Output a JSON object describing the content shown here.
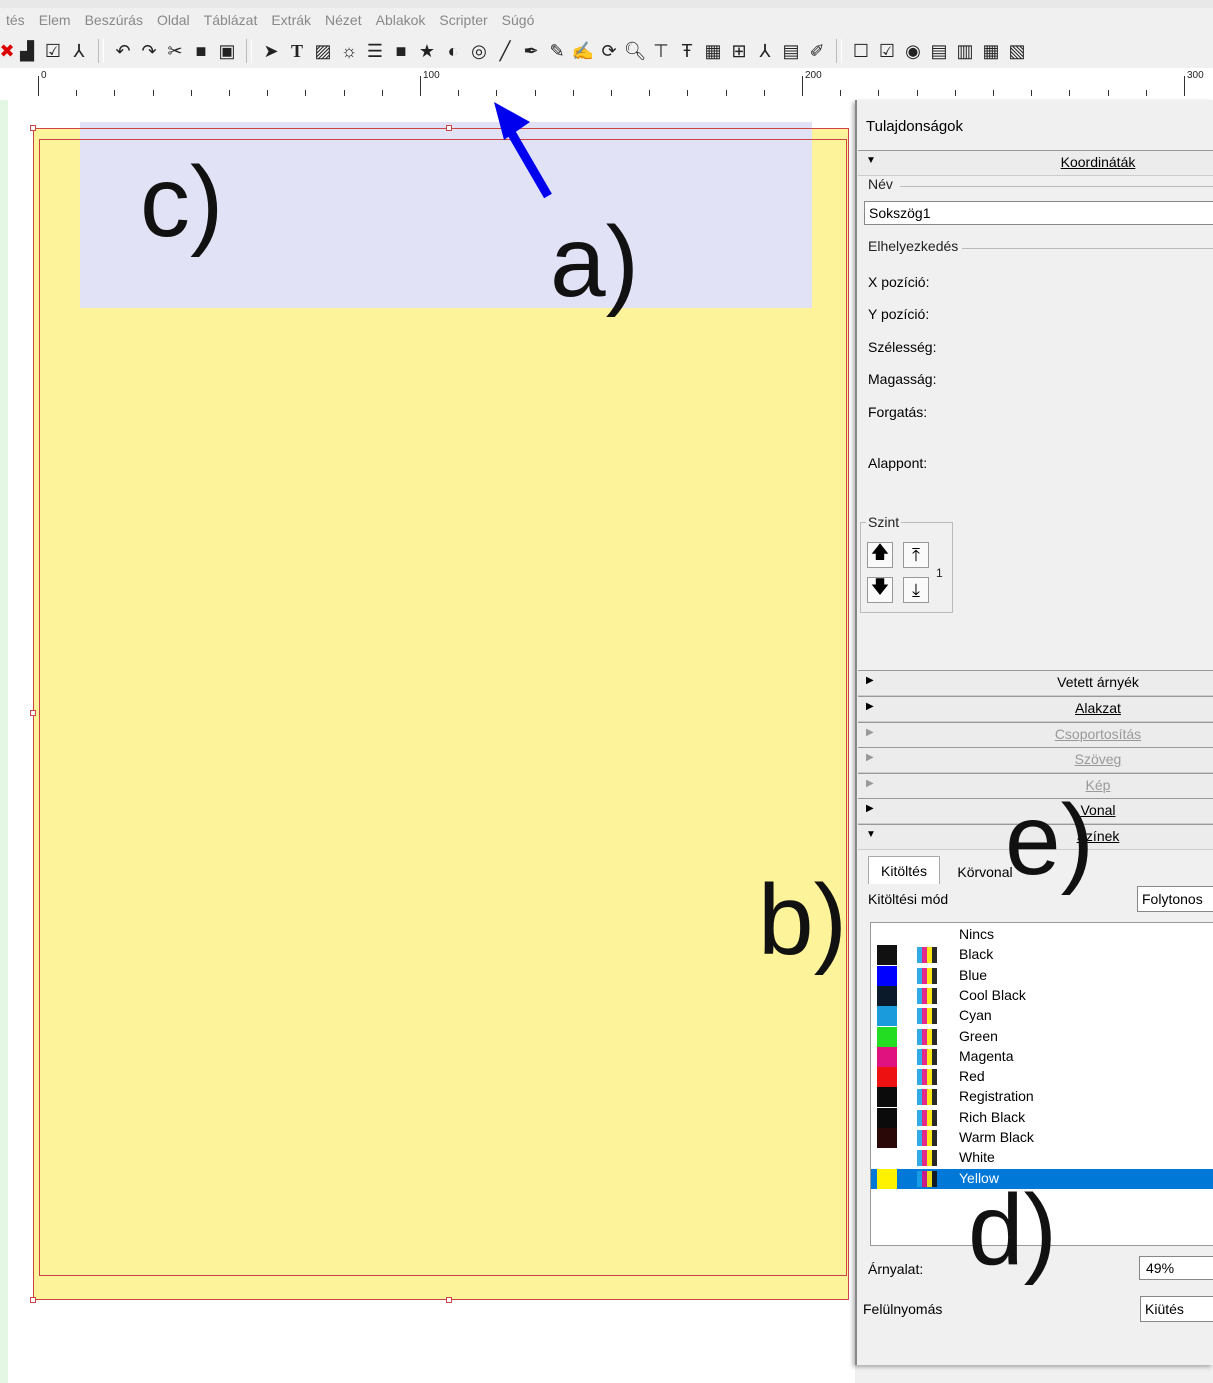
{
  "menubar": [
    "tés",
    "Elem",
    "Beszúrás",
    "Oldal",
    "Táblázat",
    "Extrák",
    "Nézet",
    "Ablakok",
    "Scripter",
    "Súgó"
  ],
  "ruler": {
    "labels": [
      "0",
      "100",
      "200",
      "300"
    ]
  },
  "annotations": {
    "a": "a)",
    "b": "b)",
    "c": "c)",
    "d": "d)",
    "e": "e)"
  },
  "panel": {
    "title": "Tulajdonságok",
    "sections": {
      "coordinates": "Koordináták",
      "shadow": "Vetett árnyék",
      "shape": "Alakzat",
      "grouping": "Csoportosítás",
      "text": "Szöveg",
      "image": "Kép",
      "line": "Vonal",
      "colors": "Színek"
    },
    "name_group": "Név",
    "name_value": "Sokszög1",
    "placement_group": "Elhelyezkedés",
    "fields": {
      "x": "X pozíció:",
      "y": "Y pozíció:",
      "width": "Szélesség:",
      "height": "Magasság:",
      "rotation": "Forgatás:",
      "basepoint": "Alappont:"
    },
    "level_group": "Szint",
    "level_value": "1",
    "tabs": {
      "fill": "Kitöltés",
      "stroke": "Körvonal"
    },
    "fill_mode_label": "Kitöltési mód",
    "fill_mode_value": "Folytonos",
    "colors": [
      {
        "name": "Nincs",
        "swatch": "#ffffff"
      },
      {
        "name": "Black",
        "swatch": "#111111"
      },
      {
        "name": "Blue",
        "swatch": "#0000ff"
      },
      {
        "name": "Cool Black",
        "swatch": "#0a1a2a"
      },
      {
        "name": "Cyan",
        "swatch": "#1a9bdc"
      },
      {
        "name": "Green",
        "swatch": "#22dd22"
      },
      {
        "name": "Magenta",
        "swatch": "#e0127f"
      },
      {
        "name": "Red",
        "swatch": "#ee1111"
      },
      {
        "name": "Registration",
        "swatch": "#0b0b0b"
      },
      {
        "name": "Rich Black",
        "swatch": "#0b0b0b"
      },
      {
        "name": "Warm Black",
        "swatch": "#2a0808"
      },
      {
        "name": "White",
        "swatch": "#ffffff"
      },
      {
        "name": "Yellow",
        "swatch": "#fff200"
      }
    ],
    "selected_color": "Yellow",
    "shade_label": "Árnyalat:",
    "shade_value": "49%",
    "overprint_label": "Felülnyomás",
    "overprint_value": "Kiütés"
  }
}
